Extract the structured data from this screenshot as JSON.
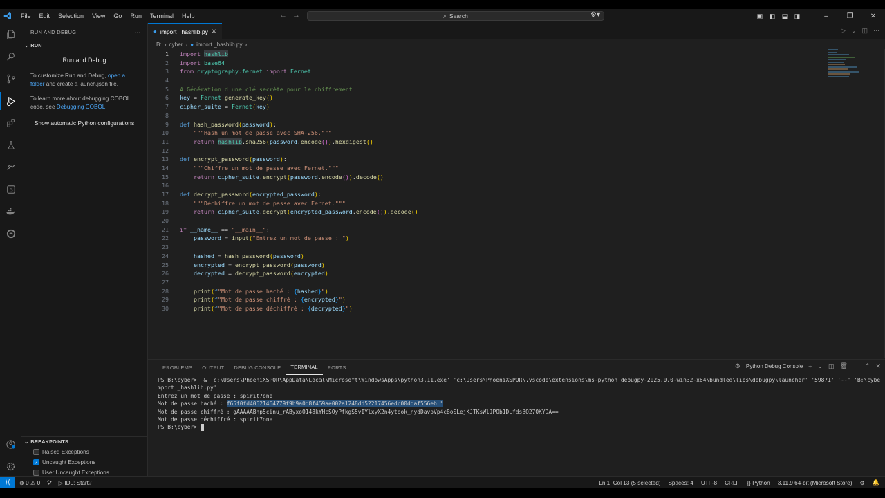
{
  "titlebar": {
    "menu": [
      "File",
      "Edit",
      "Selection",
      "View",
      "Go",
      "Run",
      "Terminal",
      "Help"
    ],
    "search_label": "Search"
  },
  "sidebar": {
    "header": "RUN AND DEBUG",
    "section": "RUN",
    "title": "Run and Debug",
    "text1_pre": "To customize Run and Debug,",
    "text1_link": "open a folder",
    "text1_post": "and create a launch.json file.",
    "text2_pre": "To learn more about debugging COBOL code, see",
    "text2_link": "Debugging COBOL",
    "text2_post": ".",
    "show_python": "Show automatic Python configurations",
    "breakpoints_header": "BREAKPOINTS",
    "breakpoints": [
      {
        "label": "Raised Exceptions",
        "checked": false
      },
      {
        "label": "Uncaught Exceptions",
        "checked": true
      },
      {
        "label": "User Uncaught Exceptions",
        "checked": false
      }
    ]
  },
  "editor": {
    "tab_label": "import _hashlib.py",
    "breadcrumb": [
      "B:",
      "cyber",
      "import _hashlib.py",
      "..."
    ],
    "cursor_line": 1
  },
  "panel": {
    "tabs": [
      "PROBLEMS",
      "OUTPUT",
      "DEBUG CONSOLE",
      "TERMINAL",
      "PORTS"
    ],
    "active_tab": "TERMINAL",
    "terminal_name": "Python Debug Console",
    "terminal_lines": [
      "PS B:\\cyber>  & 'c:\\Users\\PhoeniXSPQR\\AppData\\Local\\Microsoft\\WindowsApps\\python3.11.exe' 'c:\\Users\\PhoeniXSPQR\\.vscode\\extensions\\ms-python.debugpy-2025.0.0-win32-x64\\bundled\\libs\\debugpy\\launcher' '59871' '--' 'B:\\cyber\\i",
      "mport _hashlib.py'",
      "Entrez un mot de passe : spirit7one",
      "Mot de passe haché : ",
      "Mot de passe chiffré : gAAAAABnp5cinu_rAByxoO148kYHcSOyPfkgS5vIYlxyX2n4ytook_nydDavpVp4c8oSLejKJTKsWlJPOb1DLfdsBQ27QKYDA==",
      "Mot de passe déchiffré : spirit7one",
      "PS B:\\cyber> "
    ],
    "hash_value": "f65f0fd40621464779f9b9a0d8f459ae002a1248dd52217456edc00ddaf556eb",
    "hash_suffix": " \""
  },
  "statusbar": {
    "errors": "0",
    "warnings": "0",
    "idl": "IDL: Start?",
    "position": "Ln 1, Col 13 (5 selected)",
    "spaces": "Spaces: 4",
    "encoding": "UTF-8",
    "eol": "CRLF",
    "language": "Python",
    "interpreter": "3.11.9 64-bit (Microsoft Store)"
  },
  "icons": {
    "activity": [
      "files-icon",
      "search-icon",
      "source-control-icon",
      "run-debug-icon",
      "extensions-icon",
      "testing-icon",
      "remote-icon",
      "docker-icon",
      "cloud-icon",
      "edge-icon",
      "accounts-icon",
      "settings-gear-icon"
    ]
  },
  "colors": {
    "accent": "#0078d4",
    "keyword": "#c586c0",
    "def": "#569cd6",
    "function": "#dcdcaa",
    "string": "#ce9178",
    "comment": "#6a9955"
  }
}
